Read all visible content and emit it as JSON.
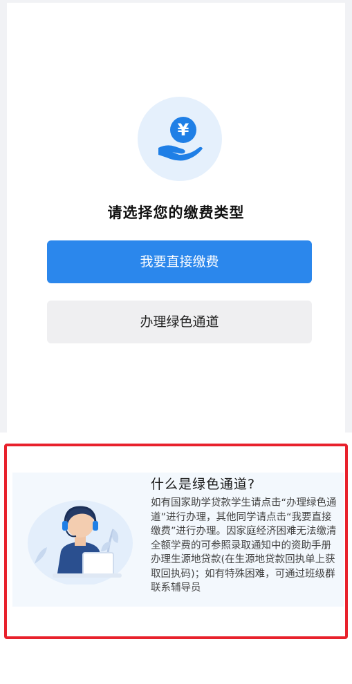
{
  "icon": "yen-hand-payment-icon",
  "prompt_title": "请选择您的缴费类型",
  "buttons": {
    "direct_pay": "我要直接缴费",
    "green_channel": "办理绿色通道"
  },
  "info": {
    "title": "什么是绿色通道?",
    "body": "如有国家助学贷款学生请点击“办理绿色通道”进行办理，其他同学请点击“我要直接缴费”进行办理。因家庭经济困难无法缴清全额学费的可参照录取通知中的资助手册办理生源地贷款(在生源地贷款回执单上获取回执码)；如有特殊困难，可通过班级群联系辅导员"
  },
  "colors": {
    "primary": "#2b87ec",
    "highlight_border": "#e8212c",
    "icon_bg": "#e5f0fc"
  }
}
